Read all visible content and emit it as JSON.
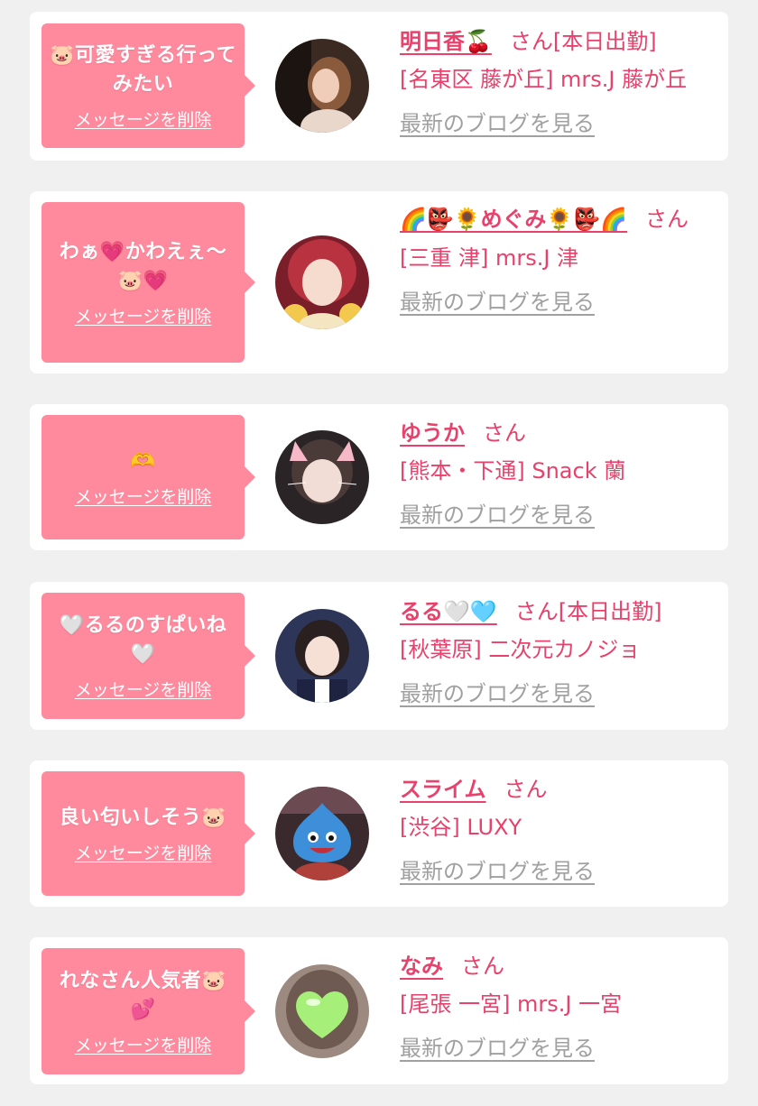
{
  "labels": {
    "delete_message": "メッセージを削除",
    "san": "さん",
    "latest_blog": "最新のブログを見る"
  },
  "colors": {
    "accent_pink": "#e8416b",
    "bubble_pink": "#ff8a9d",
    "link_gray": "#a0a0a0",
    "page_bg": "#f0f0f0",
    "card_bg": "#ffffff"
  },
  "entries": [
    {
      "message": "🐷可愛すぎる行ってみたい",
      "name": "明日香🍒",
      "status": "[本日出勤]",
      "shop": "[名東区 藤が丘] mrs.J 藤が丘",
      "avatar_icon": "woman-photo-icon"
    },
    {
      "message": "わぁ💗かわえぇ〜🐷💗",
      "name": "🌈👺🌻めぐみ🌻👺🌈",
      "status": "",
      "shop": "[三重 津] mrs.J 津",
      "avatar_icon": "woman-photo-icon"
    },
    {
      "message": "🫶",
      "name": "ゆうか",
      "status": "",
      "shop": "[熊本・下通] Snack 蘭",
      "avatar_icon": "woman-photo-icon"
    },
    {
      "message": "🤍るるのすぱいね🤍",
      "name": "るる🤍🩵",
      "status": "[本日出勤]",
      "shop": "[秋葉原] 二次元カノジョ",
      "avatar_icon": "woman-photo-icon"
    },
    {
      "message": "良い匂いしそう🐷",
      "name": "スライム",
      "status": "",
      "shop": "[渋谷] LUXY",
      "avatar_icon": "slime-photo-icon"
    },
    {
      "message": "れなさん人気者🐷💕",
      "name": "なみ",
      "status": "",
      "shop": "[尾張 一宮] mrs.J 一宮",
      "avatar_icon": "heart-covered-photo-icon"
    }
  ]
}
